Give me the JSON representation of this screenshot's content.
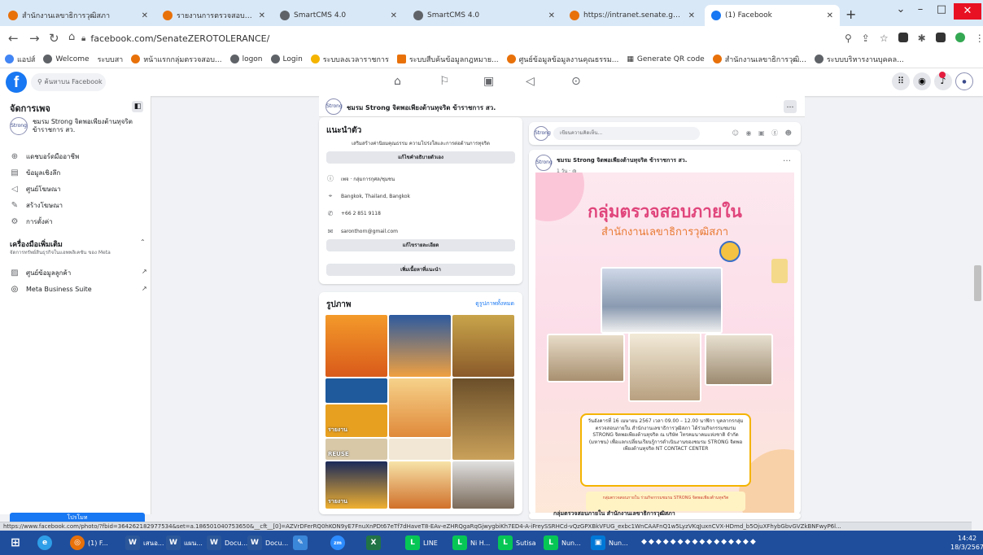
{
  "browser": {
    "tabs": [
      {
        "label": "สำนักงานเลขาธิการวุฒิสภา",
        "color": "#e8710a"
      },
      {
        "label": "รายงานการตรวจสอบภายใน 2567",
        "color": "#e8710a"
      },
      {
        "label": "SmartCMS 4.0",
        "color": "#5f6368"
      },
      {
        "label": "SmartCMS 4.0",
        "color": "#5f6368"
      },
      {
        "label": "https://intranet.senate.go.th/",
        "color": "#e8710a"
      },
      {
        "label": "(1) Facebook",
        "color": "#1877f2"
      }
    ],
    "url": "facebook.com/SenateZEROTOLERANCE/",
    "bookmarks": [
      {
        "label": "แอปส์",
        "color": "#4285f4"
      },
      {
        "label": "Welcome",
        "color": "#5f6368"
      },
      {
        "label": "ระบบสา",
        "color": "#5f6368"
      },
      {
        "label": "หน้าแรกกลุ่มตรวจสอบ...",
        "color": "#e8710a"
      },
      {
        "label": "logon",
        "color": "#5f6368"
      },
      {
        "label": "Login",
        "color": "#5f6368"
      },
      {
        "label": "ระบบลงเวลาราชการ",
        "color": "#f4b400"
      },
      {
        "label": "ระบบสืบค้นข้อมูลกฎหมาย...",
        "color": "#e8710a"
      },
      {
        "label": "ศูนย์ข้อมูลข้อมูลงานคุณธรรม...",
        "color": "#e8710a"
      },
      {
        "label": "Generate QR code",
        "color": "#5f6368"
      },
      {
        "label": "สำนักงานเลขาธิการวุฒิ...",
        "color": "#e8710a"
      },
      {
        "label": "ระบบบริหารงานบุคคล...",
        "color": "#5f6368"
      }
    ],
    "status_url": "https://www.facebook.com/photo/?fbid=364262182977534&set=a.186501040753650&__cft__[0]=AZVrDFerRQ0hKON9yE7FnuXnPDt67eTf7dHaveT8-EAv-eZHRQgaRqGjwygbiKh7ED4-A-iFreySSRHCd-vQzGPXBkVFUG_exbc1WnCAAFnQ1w5LyzVKqJuxnCVX-HDmd_b5OjuXFhybGbvGVZkBNFwyP6l..."
  },
  "facebook": {
    "search_placeholder": "ค้นหาบน Facebook"
  },
  "sidebar": {
    "title": "จัดการเพจ",
    "page_name": "ชมรม Strong จิตพอเพียงต้านทุจริต ข้าราชการ สว.",
    "avatar_text": "Strong",
    "items": [
      {
        "label": "แดชบอร์ดมืออาชีพ",
        "icon": "dashboard-icon"
      },
      {
        "label": "ข้อมูลเชิงลึก",
        "icon": "insights-icon"
      },
      {
        "label": "ศูนย์โฆษณา",
        "icon": "megaphone-icon"
      },
      {
        "label": "สร้างโฆษณา",
        "icon": "pencil-icon"
      },
      {
        "label": "การตั้งค่า",
        "icon": "gear-icon"
      }
    ],
    "tools_title": "เครื่องมือเพิ่มเติม",
    "tools_subtitle": "จัดการทรัพย์สินธุรกิจในแอพพลิเคชัน ของ Meta",
    "tool_items": [
      {
        "label": "ศูนย์ข้อมูลลูกค้า",
        "icon": "inbox-icon"
      },
      {
        "label": "Meta Business Suite",
        "icon": "meta-icon"
      }
    ],
    "promote_label": "โปรโมท"
  },
  "page_header": {
    "name": "ชมรม Strong จิตพอเพียงต้านทุจริต ข้าราชการ สว."
  },
  "intro": {
    "title": "แนะนำตัว",
    "bio": "เสริมสร้างค่านิยมคุณธรรม ความโปร่งใสและการต่อต้านการทุจริต",
    "edit_bio_label": "แก้ไขคำอธิบายตัวเอง",
    "category": "เพจ · กลุ่มการกุศล/ชุมชน",
    "location": "Bangkok, Thailand, Bangkok",
    "phone": "+66 2 851 9118",
    "email": "saronthorn@gmail.com",
    "edit_details_label": "แก้ไขรายละเอียด",
    "add_featured_label": "เพิ่มเนื้อหาที่แนะนำ"
  },
  "photos": {
    "title": "รูปภาพ",
    "see_all": "ดูรูปภาพทั้งหมด",
    "thumb_texts": [
      "",
      "",
      "",
      "",
      "รายงาน",
      "",
      "REUSE",
      "",
      "",
      "รายงาน",
      "",
      ""
    ]
  },
  "composer": {
    "placeholder": "เขียนความคิดเห็น..."
  },
  "post": {
    "author": "ชมรม Strong จิตพอเพียงต้านทุจริต ข้าราชการ สว.",
    "time": "1 วัน",
    "headline": "กลุ่มตรวจสอบภายใน",
    "subheadline": "สำนักงานเลขาธิการวุฒิสภา",
    "body": "วันอังคารที่ 16 เมษายน 2567 เวลา 09.00 – 12.00 นาฬิกา บุคลากรกลุ่มตรวจสอบภายใน สำนักงานเลขาธิการวุฒิสภา ได้ร่วมกิจกรรมชมรม STRONG จิตพอเพียงต้านทุจริต ณ บริษัท โทรคมนาคมแห่งชาติ จำกัด (มหาชน) เพื่อแลกเปลี่ยนเรียนรู้การดำเนินงานของชมรม STRONG จิตพอเพียงต้านทุจริต NT CONTACT CENTER",
    "footer": "กลุ่มตรวจสอบภายใน ร่วมกิจกรรมชมรม STRONG จิตพอเพียงต้านทุจริต"
  },
  "next_post": {
    "author": "กลุ่มตรวจสอบภายใน สำนักงานเลขาธิการวุฒิสภา"
  },
  "taskbar": {
    "items": [
      {
        "label": "",
        "icon": "windows-icon",
        "color": "#1f4e9c"
      },
      {
        "label": "",
        "icon": "ie-icon",
        "color": "#2e9ee8"
      },
      {
        "label": "(1) F...",
        "icon": "chrome-icon",
        "color": "#e8710a"
      },
      {
        "label": "เสนอ...",
        "icon": "word-icon",
        "color": "#2b579a"
      },
      {
        "label": "แผน...",
        "icon": "word-icon",
        "color": "#2b579a"
      },
      {
        "label": "Docu...",
        "icon": "word-icon",
        "color": "#2b579a"
      },
      {
        "label": "Docu...",
        "icon": "word-icon",
        "color": "#2b579a"
      },
      {
        "label": "",
        "icon": "paint-icon",
        "color": "#3a86d8"
      },
      {
        "label": "",
        "icon": "zoom-icon",
        "color": "#2d8cff"
      },
      {
        "label": "",
        "icon": "excel-icon",
        "color": "#217346"
      },
      {
        "label": "LINE",
        "icon": "line-icon",
        "color": "#06c755"
      },
      {
        "label": "Ni H...",
        "icon": "line-icon",
        "color": "#06c755"
      },
      {
        "label": "Sutisa",
        "icon": "line-icon",
        "color": "#06c755"
      },
      {
        "label": "Nun...",
        "icon": "line-icon",
        "color": "#06c755"
      },
      {
        "label": "Nun...",
        "icon": "photos-icon",
        "color": "#0078d7"
      }
    ],
    "time": "14:42",
    "date": "18/3/2567"
  }
}
